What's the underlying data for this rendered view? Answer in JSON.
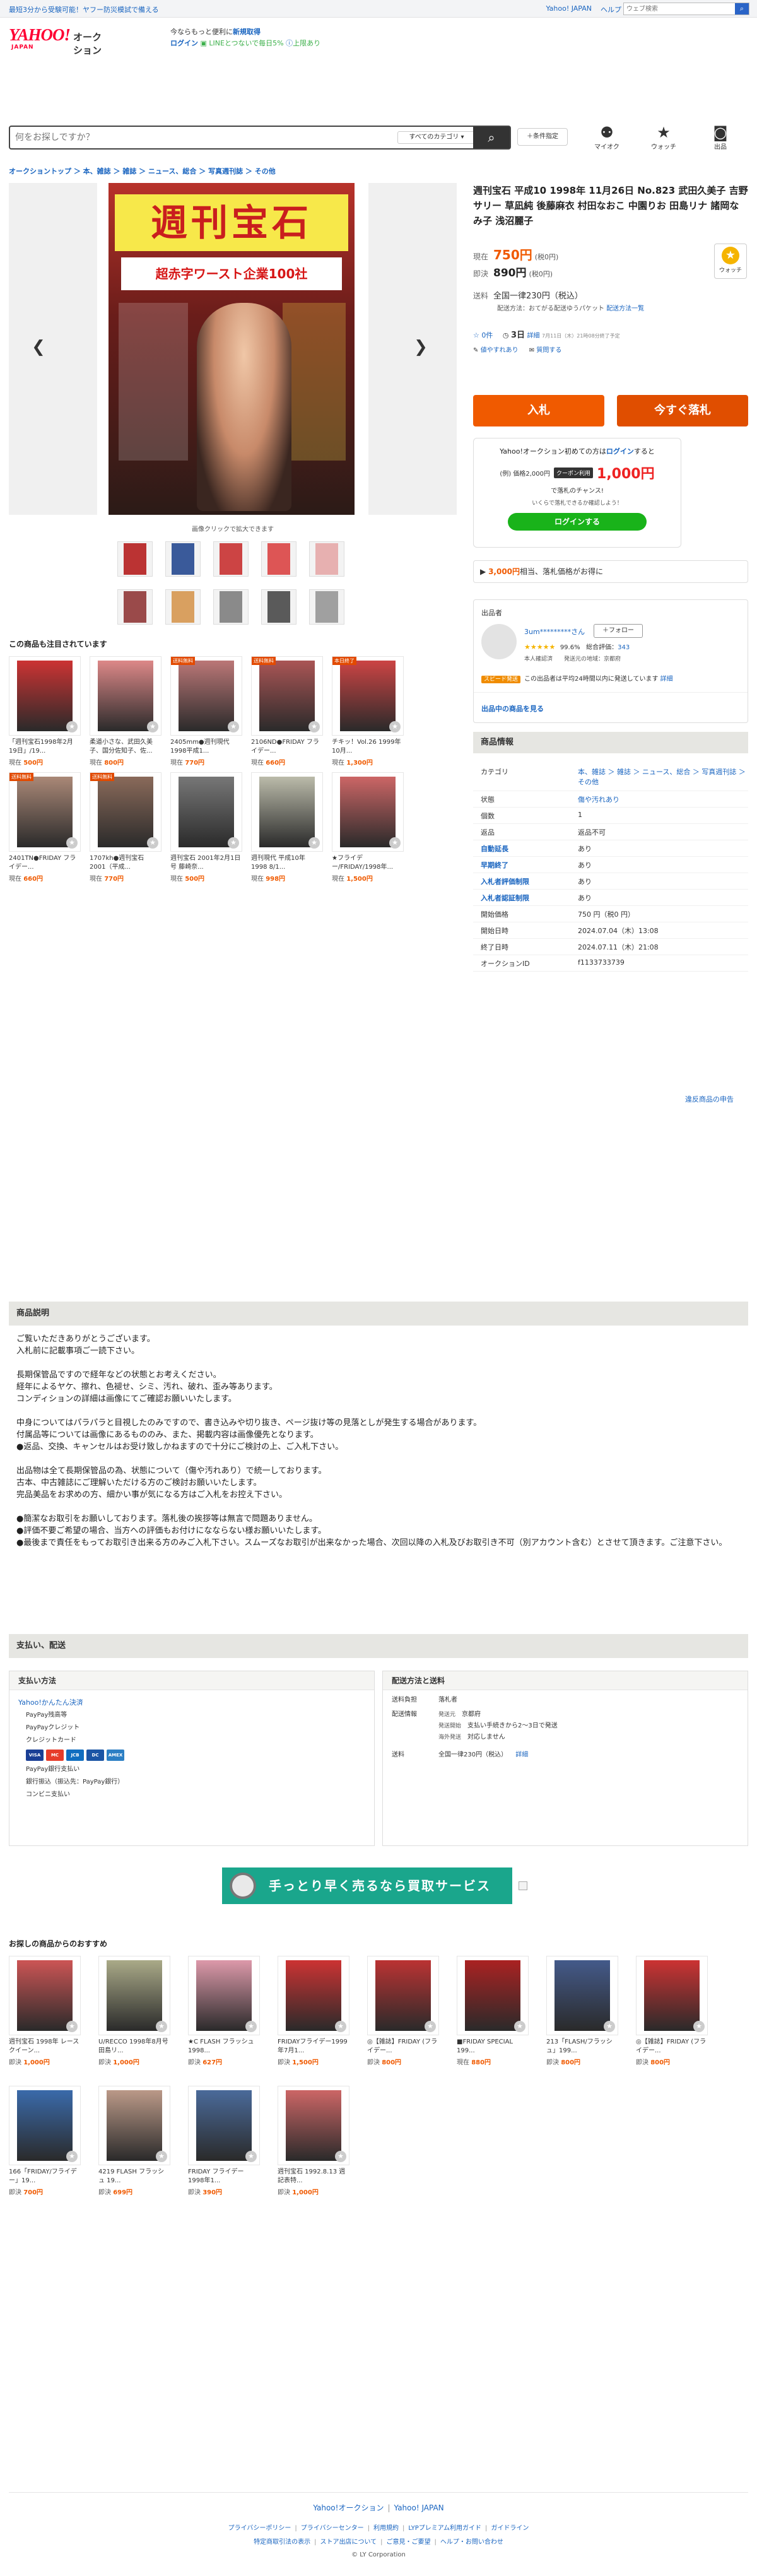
{
  "topbar": {
    "promo": "最短3分から受験可能！ヤフー防災模試で備える",
    "links": [
      "Yahoo! JAPAN",
      "ヘルプ"
    ],
    "search_placeholder": "ウェブ検索"
  },
  "header": {
    "logo_text": "YAHOO!",
    "logo_sub": "JAPAN",
    "site_name": "オークション",
    "info_line1": "今ならもっと便利に",
    "info_line1_bold": "新規取得",
    "info_line2_login": "ログイン",
    "info_line2_text": "LINEとつないで毎日5%",
    "info_line2_green": "上限あり"
  },
  "search": {
    "placeholder": "何をお探しですか？",
    "category": "すべてのカテゴリ",
    "conditions": "＋条件指定",
    "icons": [
      {
        "name": "mypage",
        "label": "マイオク",
        "glyph": "👤"
      },
      {
        "name": "watch",
        "label": "ウォッチ",
        "glyph": "★"
      },
      {
        "name": "sell",
        "label": "出品",
        "glyph": "📷"
      }
    ]
  },
  "breadcrumb": "オークショントップ ＞ 本、雑誌 ＞ 雑誌 ＞ ニュース、総合 ＞ 写真週刊誌 ＞ その他",
  "gallery": {
    "cover_title": "週刊宝石",
    "cover_headline": "超赤字ワースト企業100社",
    "note": "画像クリックで拡大できます",
    "thumb_colors": [
      "#b33",
      "#3a5a9a",
      "#c44",
      "#d55",
      "#e7b0b0",
      "#9a4a4a",
      "#d9a060",
      "#8a8a8a",
      "#5a5a5a",
      "#a0a0a0"
    ]
  },
  "item": {
    "title": "週刊宝石 平成10 1998年 11月26日 No.823 武田久美子 吉野サリー 草凪純 後藤麻衣 村田なおこ 中園りお 田島リナ 諸岡なみ子 浅沼麗子",
    "price_label": "現在",
    "price": "750円",
    "price_tax": "(税0円)",
    "buynow_label": "即決",
    "buynow_price": "890円",
    "buynow_tax": "(税0円)",
    "shipping_label": "送料",
    "shipping_value": "全国一律230円（税込）",
    "shipping_sub": "配送方法：おてがる配送ゆうパケット",
    "shipping_link": "配送方法一覧",
    "watch_label": "ウォッチ",
    "watch_count": "0件",
    "time_left": "3日",
    "time_detail": "詳細",
    "time_note": "7月11日（木）21時08分終了予定",
    "seller_link": "値やすれあり",
    "qa_link": "質問する",
    "bid_button": "入札",
    "buynow_button": "今すぐ落札"
  },
  "promo_card": {
    "line1_a": "Yahoo!オークション初めての方は",
    "line1_login": "ログイン",
    "line1_b": "すると",
    "line2_a": "(例) 価格2,000円",
    "line2_coupon": "クーポン利用",
    "line2_amount": "1,000円",
    "line2_b": "で落札のチャンス!",
    "line3": "いくらで落札できるか確認しよう！",
    "login_button": "ログインする"
  },
  "points": {
    "amount": "3,000円",
    "text": "相当、落札価格がお得に"
  },
  "seller": {
    "heading": "出品者",
    "name": "3um*********さん",
    "follow": "＋フォロー",
    "stars": "★★★★★",
    "percent": "99.6%",
    "rating_label": "総合評価：",
    "rating_value": "343",
    "verify": "本人確認済　　発送元の地域：京都府",
    "speed_tag": "スピード発送",
    "speed_text": "この出品者は平均24時間以内に発送しています",
    "speed_link": "詳細",
    "more": "出品中の商品を見る"
  },
  "info": {
    "heading": "商品情報",
    "rows": [
      {
        "k": "カテゴリ",
        "v": "本、雑誌 ＞ 雑誌 ＞ ニュース、総合 ＞ 写真週刊誌 ＞ その他"
      },
      {
        "k": "状態",
        "v": "傷や汚れあり"
      },
      {
        "k": "個数",
        "v": "1"
      },
      {
        "k": "返品",
        "v": "返品不可"
      },
      {
        "k": "自動延長",
        "v": "あり"
      },
      {
        "k": "早期終了",
        "v": "あり"
      },
      {
        "k": "入札者評価制限",
        "v": "あり"
      },
      {
        "k": "入札者認証制限",
        "v": "あり"
      },
      {
        "k": "開始価格",
        "v": "750 円（税0 円）"
      },
      {
        "k": "開始日時",
        "v": "2024.07.04（木）13:08"
      },
      {
        "k": "終了日時",
        "v": "2024.07.11（木）21:08"
      },
      {
        "k": "オークションID",
        "v": "f1133733739"
      }
    ],
    "report": "違反商品の申告"
  },
  "attention": {
    "heading": "この商品も注目されています",
    "items": [
      {
        "title": "「週刊宝石1998年2月19日」/19...",
        "label": "現在",
        "price": "500円",
        "badge": "",
        "color": "#c33"
      },
      {
        "title": "柔道小さな、武田久美子、国分佐知子、佐...",
        "label": "現在",
        "price": "800円",
        "badge": "",
        "color": "#d88"
      },
      {
        "title": "2405mm●週刊現代 1998平成1...",
        "label": "現在",
        "price": "770円",
        "badge": "送料無料",
        "color": "#b77"
      },
      {
        "title": "2106ND●FRIDAY フライデー...",
        "label": "現在",
        "price": "660円",
        "badge": "送料無料",
        "color": "#a55"
      },
      {
        "title": "チキッ！Vol.26 1999年10月...",
        "label": "現在",
        "price": "1,300円",
        "badge": "本日終了",
        "color": "#c44"
      },
      {
        "title": "2401TN●FRIDAY フライデー...",
        "label": "現在",
        "price": "660円",
        "badge": "送料無料",
        "color": "#a87"
      },
      {
        "title": "1707kh●週刊宝石 2001（平成...",
        "label": "現在",
        "price": "770円",
        "badge": "送料無料",
        "color": "#8a6a5a"
      },
      {
        "title": "週刊宝石 2001年2月1日号 藤崎奈...",
        "label": "現在",
        "price": "500円",
        "badge": "",
        "color": "#777"
      },
      {
        "title": "週刊現代 平成10年 1998 8/1...",
        "label": "現在",
        "price": "998円",
        "badge": "",
        "color": "#bba"
      },
      {
        "title": "★フライデー/FRIDAY/1998年...",
        "label": "現在",
        "price": "1,500円",
        "badge": "",
        "color": "#c66"
      }
    ]
  },
  "description": {
    "heading": "商品説明",
    "lines": [
      "ご覧いただきありがとうございます。",
      "入札前に記載事項ご一読下さい。",
      "",
      "長期保管品ですので経年などの状態とお考えください。",
      "経年によるヤケ、擦れ、色褪せ、シミ、汚れ、破れ、歪み等あります。",
      "コンディションの詳細は画像にてご確認お願いいたします。",
      "",
      "中身についてはパラパラと目視したのみですので、書き込みや切り抜き、ページ抜け等の見落としが発生する場合があります。",
      "付属品等については画像にあるもののみ、また、掲載内容は画像優先となります。",
      "●返品、交換、キャンセルはお受け致しかねますので十分にご検討の上、ご入札下さい。",
      "",
      "出品物は全て長期保管品の為、状態について（傷や汚れあり）で統一しております。",
      "古本、中古雑誌にご理解いただける方のご検討お願いいたします。",
      "完品美品をお求めの方、細かい事が気になる方はご入札をお控え下さい。",
      "",
      "●簡潔なお取引をお願いしております。落札後の挨拶等は無言で問題ありません。",
      "●評価不要ご希望の場合、当方への評価もお付けになならない様お願いいたします。",
      "●最後まで責任をもってお取引き出来る方のみご入札下さい。スムーズなお取引が出来なかった場合、次回以降の入札及びお取引き不可（別アカウント含む）とさせて頂きます。ご注意下さい。"
    ]
  },
  "payment": {
    "heading": "支払い、配送",
    "pay_title": "支払い方法",
    "pay_main": "Yahoo!かんたん決済",
    "pay_items": [
      "PayPay残高等",
      "PayPayクレジット",
      "クレジットカード"
    ],
    "card_logos": [
      "VISA",
      "MC",
      "JCB",
      "DC",
      "AMEX"
    ],
    "card_colors": [
      "#1a3f95",
      "#e73c2a",
      "#116ec0",
      "#1b55a5",
      "#2c7fc4"
    ],
    "pay_items2": [
      "PayPay銀行支払い",
      "銀行振込（振込先：PayPay銀行）",
      "コンビニ支払い"
    ],
    "ship_title": "配送方法と送料",
    "ship_rows": [
      {
        "k": "送料負担",
        "v": "落札者"
      },
      {
        "k": "配送情報",
        "v": "京都府"
      },
      {
        "k": "",
        "v": "支払い手続きから2〜3日で発送"
      },
      {
        "k": "",
        "v": "対応しません"
      },
      {
        "k": "送料",
        "v": "全国一律230円（税込）"
      }
    ],
    "ship_sub_labels": [
      "発送元",
      "発送開始",
      "海外発送"
    ],
    "ship_detail": "詳細"
  },
  "banner": {
    "text": "手っとり早く売るなら買取サービス"
  },
  "recommend": {
    "heading": "お探しの商品からのおすすめ",
    "items": [
      {
        "title": "週刊宝石 1998年 レースクイーン...",
        "label": "即決",
        "price": "1,000円",
        "color": "#c55"
      },
      {
        "title": "U/RECCO 1998年8月号 田島リ...",
        "label": "即決",
        "price": "1,000円",
        "color": "#aa8"
      },
      {
        "title": "★C FLASH フラッシュ 1998...",
        "label": "即決",
        "price": "627円",
        "color": "#d9a"
      },
      {
        "title": "FRIDAYフライデー1999年7月1...",
        "label": "即決",
        "price": "1,500円",
        "color": "#c33"
      },
      {
        "title": "◎【雑誌】FRIDAY (フライデー...",
        "label": "即決",
        "price": "800円",
        "color": "#b33"
      },
      {
        "title": "■FRIDAY SPECIAL 199...",
        "label": "現在",
        "price": "880円",
        "color": "#a22"
      },
      {
        "title": "213「FLASH/フラッシュ」199...",
        "label": "即決",
        "price": "800円",
        "color": "#445a8a"
      },
      {
        "title": "◎【雑誌】FRIDAY (フライデー...",
        "label": "即決",
        "price": "800円",
        "color": "#c33"
      },
      {
        "title": "166「FRIDAY/フライデー」19...",
        "label": "即決",
        "price": "700円",
        "color": "#3a6aaa"
      },
      {
        "title": "4219 FLASH フラッシュ 19...",
        "label": "即決",
        "price": "699円",
        "color": "#b98"
      },
      {
        "title": "FRIDAY フライデー 1998年1...",
        "label": "即決",
        "price": "390円",
        "color": "#4a6a9a"
      },
      {
        "title": "週刊宝石 1992.8.13 週記表特...",
        "label": "即決",
        "price": "1,000円",
        "color": "#c66"
      }
    ]
  },
  "footer": {
    "line1": [
      "Yahoo!オークション",
      "Yahoo! JAPAN"
    ],
    "line2": [
      "プライバシーポリシー",
      "プライバシーセンター",
      "利用規約",
      "LYPプレミアム利用ガイド",
      "ガイドライン"
    ],
    "line3": [
      "特定商取引法の表示",
      "ストア出店について",
      "ご意見・ご要望",
      "ヘルプ・お問い合わせ"
    ],
    "copyright": "© LY Corporation"
  }
}
